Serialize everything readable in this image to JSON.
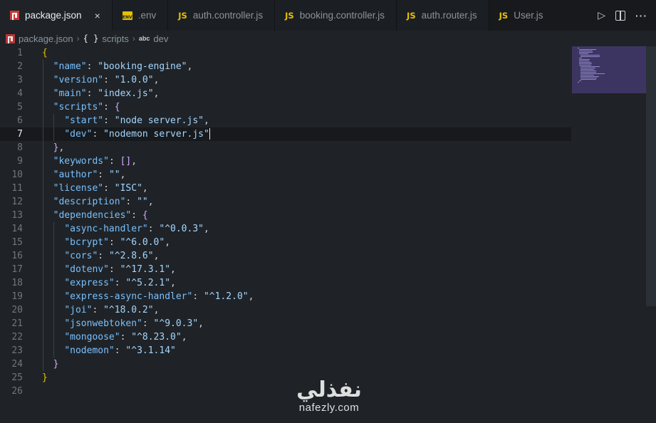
{
  "tabs": [
    {
      "label": "package.json",
      "icon": "npm-icon",
      "active": true
    },
    {
      "label": ".env",
      "icon": "env-icon",
      "icon_text": "ENV"
    },
    {
      "label": "auth.controller.js",
      "icon": "js-icon",
      "icon_text": "JS"
    },
    {
      "label": "booking.controller.js",
      "icon": "js-icon",
      "icon_text": "JS"
    },
    {
      "label": "auth.router.js",
      "icon": "js-icon",
      "icon_text": "JS"
    },
    {
      "label": "User.js",
      "icon": "js-icon",
      "icon_text": "JS"
    }
  ],
  "tab_close": "×",
  "actions": {
    "run_icon": "run-icon",
    "split_icon": "split-editor-icon",
    "more_icon": "more-actions-icon",
    "run_glyph": "▷",
    "more_glyph": "···"
  },
  "breadcrumb": {
    "file": "package.json",
    "sep": "›",
    "braces": "{ }",
    "section": "scripts",
    "abc": "abc",
    "item": "dev"
  },
  "editor": {
    "current_line": 7,
    "lines": [
      {
        "n": "1",
        "tokens": [
          {
            "t": "{",
            "c": "br1"
          }
        ]
      },
      {
        "n": "2",
        "tokens": [
          {
            "t": "  "
          },
          {
            "t": "\"name\"",
            "c": "key"
          },
          {
            "t": ": "
          },
          {
            "t": "\"booking-engine\"",
            "c": "str"
          },
          {
            "t": ","
          }
        ]
      },
      {
        "n": "3",
        "tokens": [
          {
            "t": "  "
          },
          {
            "t": "\"version\"",
            "c": "key"
          },
          {
            "t": ": "
          },
          {
            "t": "\"1.0.0\"",
            "c": "str"
          },
          {
            "t": ","
          }
        ]
      },
      {
        "n": "4",
        "tokens": [
          {
            "t": "  "
          },
          {
            "t": "\"main\"",
            "c": "key"
          },
          {
            "t": ": "
          },
          {
            "t": "\"index.js\"",
            "c": "str"
          },
          {
            "t": ","
          }
        ]
      },
      {
        "n": "5",
        "tokens": [
          {
            "t": "  "
          },
          {
            "t": "\"scripts\"",
            "c": "key"
          },
          {
            "t": ": "
          },
          {
            "t": "{",
            "c": "br2"
          }
        ]
      },
      {
        "n": "6",
        "tokens": [
          {
            "t": "    "
          },
          {
            "t": "\"start\"",
            "c": "key"
          },
          {
            "t": ": "
          },
          {
            "t": "\"node server.js\"",
            "c": "str"
          },
          {
            "t": ","
          }
        ]
      },
      {
        "n": "7",
        "tokens": [
          {
            "t": "    "
          },
          {
            "t": "\"dev\"",
            "c": "key"
          },
          {
            "t": ": "
          },
          {
            "t": "\"nodemon server.js\"",
            "c": "str"
          }
        ],
        "cursor": true
      },
      {
        "n": "8",
        "tokens": [
          {
            "t": "  "
          },
          {
            "t": "}",
            "c": "br2"
          },
          {
            "t": ","
          }
        ]
      },
      {
        "n": "9",
        "tokens": [
          {
            "t": "  "
          },
          {
            "t": "\"keywords\"",
            "c": "key"
          },
          {
            "t": ": "
          },
          {
            "t": "[]",
            "c": "br2"
          },
          {
            "t": ","
          }
        ]
      },
      {
        "n": "10",
        "tokens": [
          {
            "t": "  "
          },
          {
            "t": "\"author\"",
            "c": "key"
          },
          {
            "t": ": "
          },
          {
            "t": "\"\"",
            "c": "str"
          },
          {
            "t": ","
          }
        ]
      },
      {
        "n": "11",
        "tokens": [
          {
            "t": "  "
          },
          {
            "t": "\"license\"",
            "c": "key"
          },
          {
            "t": ": "
          },
          {
            "t": "\"ISC\"",
            "c": "str"
          },
          {
            "t": ","
          }
        ]
      },
      {
        "n": "12",
        "tokens": [
          {
            "t": "  "
          },
          {
            "t": "\"description\"",
            "c": "key"
          },
          {
            "t": ": "
          },
          {
            "t": "\"\"",
            "c": "str"
          },
          {
            "t": ","
          }
        ]
      },
      {
        "n": "13",
        "tokens": [
          {
            "t": "  "
          },
          {
            "t": "\"dependencies\"",
            "c": "key"
          },
          {
            "t": ": "
          },
          {
            "t": "{",
            "c": "br2"
          }
        ]
      },
      {
        "n": "14",
        "tokens": [
          {
            "t": "    "
          },
          {
            "t": "\"async-handler\"",
            "c": "key"
          },
          {
            "t": ": "
          },
          {
            "t": "\"^0.0.3\"",
            "c": "str"
          },
          {
            "t": ","
          }
        ]
      },
      {
        "n": "15",
        "tokens": [
          {
            "t": "    "
          },
          {
            "t": "\"bcrypt\"",
            "c": "key"
          },
          {
            "t": ": "
          },
          {
            "t": "\"^6.0.0\"",
            "c": "str"
          },
          {
            "t": ","
          }
        ]
      },
      {
        "n": "16",
        "tokens": [
          {
            "t": "    "
          },
          {
            "t": "\"cors\"",
            "c": "key"
          },
          {
            "t": ": "
          },
          {
            "t": "\"^2.8.6\"",
            "c": "str"
          },
          {
            "t": ","
          }
        ]
      },
      {
        "n": "17",
        "tokens": [
          {
            "t": "    "
          },
          {
            "t": "\"dotenv\"",
            "c": "key"
          },
          {
            "t": ": "
          },
          {
            "t": "\"^17.3.1\"",
            "c": "str"
          },
          {
            "t": ","
          }
        ]
      },
      {
        "n": "18",
        "tokens": [
          {
            "t": "    "
          },
          {
            "t": "\"express\"",
            "c": "key"
          },
          {
            "t": ": "
          },
          {
            "t": "\"^5.2.1\"",
            "c": "str"
          },
          {
            "t": ","
          }
        ]
      },
      {
        "n": "19",
        "tokens": [
          {
            "t": "    "
          },
          {
            "t": "\"express-async-handler\"",
            "c": "key"
          },
          {
            "t": ": "
          },
          {
            "t": "\"^1.2.0\"",
            "c": "str"
          },
          {
            "t": ","
          }
        ]
      },
      {
        "n": "20",
        "tokens": [
          {
            "t": "    "
          },
          {
            "t": "\"joi\"",
            "c": "key"
          },
          {
            "t": ": "
          },
          {
            "t": "\"^18.0.2\"",
            "c": "str"
          },
          {
            "t": ","
          }
        ]
      },
      {
        "n": "21",
        "tokens": [
          {
            "t": "    "
          },
          {
            "t": "\"jsonwebtoken\"",
            "c": "key"
          },
          {
            "t": ": "
          },
          {
            "t": "\"^9.0.3\"",
            "c": "str"
          },
          {
            "t": ","
          }
        ]
      },
      {
        "n": "22",
        "tokens": [
          {
            "t": "    "
          },
          {
            "t": "\"mongoose\"",
            "c": "key"
          },
          {
            "t": ": "
          },
          {
            "t": "\"^8.23.0\"",
            "c": "str"
          },
          {
            "t": ","
          }
        ]
      },
      {
        "n": "23",
        "tokens": [
          {
            "t": "    "
          },
          {
            "t": "\"nodemon\"",
            "c": "key"
          },
          {
            "t": ": "
          },
          {
            "t": "\"^3.1.14\"",
            "c": "str"
          }
        ]
      },
      {
        "n": "24",
        "tokens": [
          {
            "t": "  "
          },
          {
            "t": "}",
            "c": "br2"
          }
        ]
      },
      {
        "n": "25",
        "tokens": [
          {
            "t": "}",
            "c": "br1"
          }
        ]
      },
      {
        "n": "26",
        "tokens": []
      }
    ]
  },
  "watermark": {
    "arabic": "نفذلي",
    "latin": "nafezly.com"
  },
  "colors": {
    "key": "#79c0ff",
    "string": "#a5d6ff",
    "bracket1": "#e5c100",
    "bracket2": "#d2a8ff",
    "minimap": "#3d3561"
  }
}
